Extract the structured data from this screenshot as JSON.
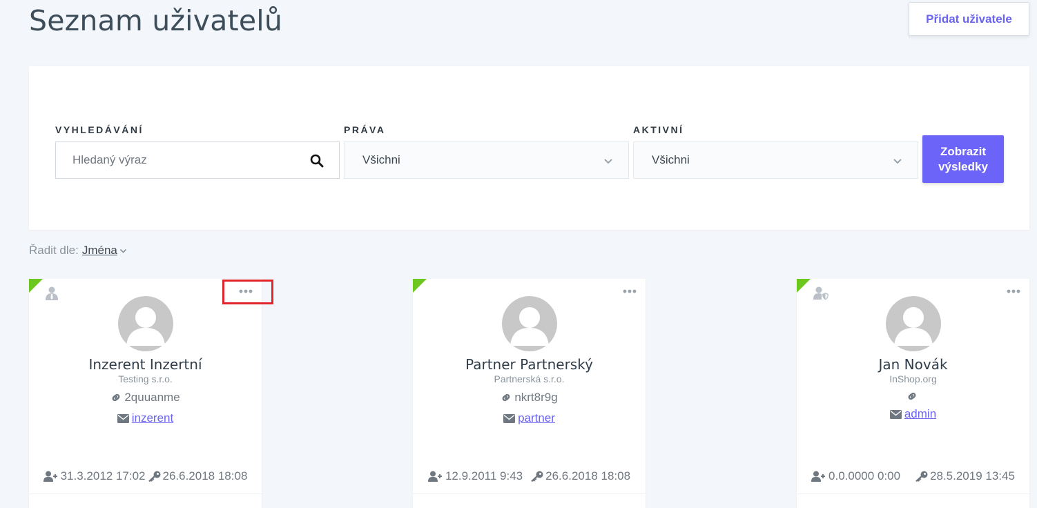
{
  "header": {
    "title": "Seznam uživatelů",
    "add_button": "Přidat uživatele"
  },
  "filters": {
    "search_label": "VYHLEDÁVÁNÍ",
    "search_placeholder": "Hledaný výraz",
    "search_value": "",
    "rights_label": "PRÁVA",
    "rights_value": "Všichni",
    "active_label": "AKTIVNÍ",
    "active_value": "Všichni",
    "submit_line1": "Zobrazit",
    "submit_line2": "výsledky"
  },
  "sort": {
    "label": "Řadit dle:",
    "value": "Jména"
  },
  "colors": {
    "accent": "#6c63f8",
    "active_corner": "#6cc71f",
    "highlight": "#e0242a"
  },
  "users": [
    {
      "type_icon": "advertiser-user-icon",
      "name": "Inzerent Inzertní",
      "company": "Testing s.r.o.",
      "code": "2quuanme",
      "email_link": "inzerent",
      "registered": "31.3.2012 17:02",
      "last_login": "26.6.2018 18:08"
    },
    {
      "type_icon": "none",
      "name": "Partner Partnerský",
      "company": "Partnerská s.r.o.",
      "code": "nkrt8r9g",
      "email_link": "partner",
      "registered": "12.9.2011 9:43",
      "last_login": "26.6.2018 18:08"
    },
    {
      "type_icon": "admin-user-shield-icon",
      "name": "Jan Novák",
      "company": "InShop.org",
      "code": "",
      "email_link": "admin",
      "registered": "0.0.0000 0:00",
      "last_login": "28.5.2019 13:45"
    }
  ]
}
